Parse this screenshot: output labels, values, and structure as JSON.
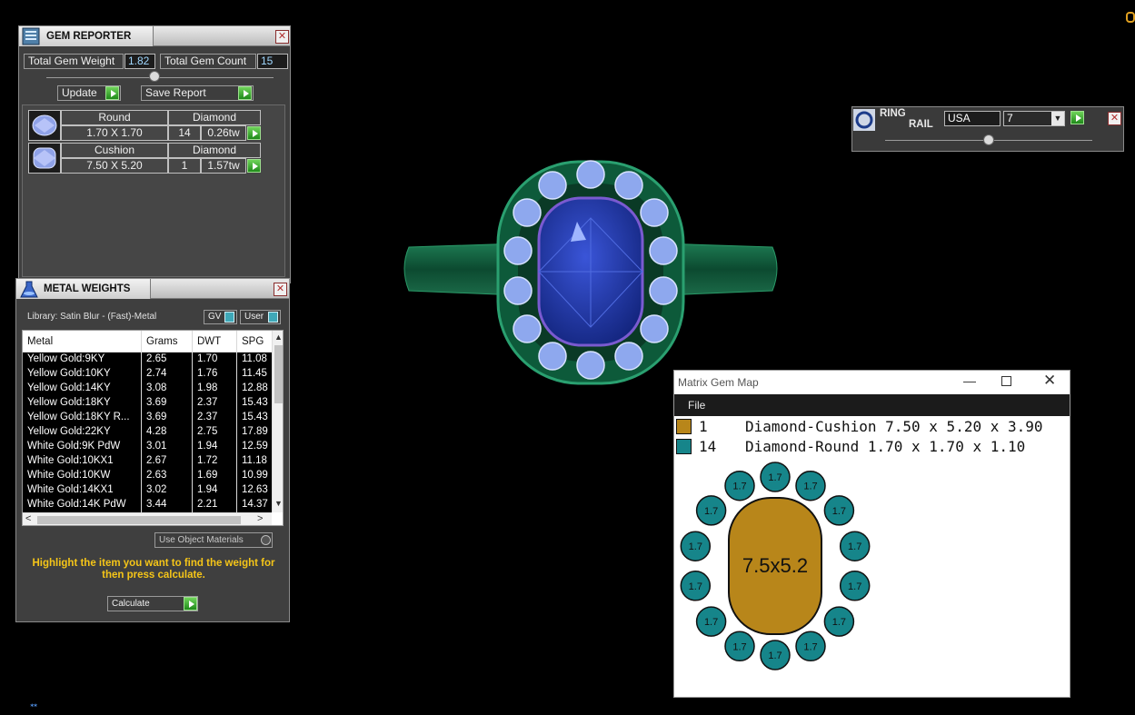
{
  "gem_reporter": {
    "title": "GEM REPORTER",
    "total_weight_label": "Total Gem Weight",
    "total_weight_value": "1.82",
    "total_count_label": "Total Gem Count",
    "total_count_value": "15",
    "update_label": "Update",
    "save_label": "Save Report",
    "gems": [
      {
        "shape": "Round",
        "type": "Diamond",
        "size": "1.70 X 1.70",
        "count": "14",
        "weight": "0.26tw"
      },
      {
        "shape": "Cushion",
        "type": "Diamond",
        "size": "7.50 X 5.20",
        "count": "1",
        "weight": "1.57tw"
      }
    ]
  },
  "metal_weights": {
    "title": "METAL WEIGHTS",
    "library": "Library: Satin Blur - (Fast)-Metal",
    "gv_label": "GV",
    "user_label": "User",
    "columns": [
      "Metal",
      "Grams",
      "DWT",
      "SPG"
    ],
    "rows": [
      [
        "Yellow Gold:9KY",
        "2.65",
        "1.70",
        "11.08"
      ],
      [
        "Yellow Gold:10KY",
        "2.74",
        "1.76",
        "11.45"
      ],
      [
        "Yellow Gold:14KY",
        "3.08",
        "1.98",
        "12.88"
      ],
      [
        "Yellow Gold:18KY",
        "3.69",
        "2.37",
        "15.43"
      ],
      [
        "Yellow Gold:18KY R...",
        "3.69",
        "2.37",
        "15.43"
      ],
      [
        "Yellow Gold:22KY",
        "4.28",
        "2.75",
        "17.89"
      ],
      [
        "White Gold:9K PdW",
        "3.01",
        "1.94",
        "12.59"
      ],
      [
        "White Gold:10KX1",
        "2.67",
        "1.72",
        "11.18"
      ],
      [
        "White Gold:10KW",
        "2.63",
        "1.69",
        "10.99"
      ],
      [
        "White Gold:14KX1",
        "3.02",
        "1.94",
        "12.63"
      ],
      [
        "White Gold:14K PdW",
        "3.44",
        "2.21",
        "14.37"
      ]
    ],
    "use_object_materials": "Use Object Materials",
    "hint": "Highlight the item you want to find the weight for then press calculate.",
    "calculate_label": "Calculate"
  },
  "ring_rail": {
    "title_line1": "RING",
    "title_line2": "RAIL",
    "region": "USA",
    "size": "7"
  },
  "gem_map": {
    "title": "Matrix Gem Map",
    "menu_file": "File",
    "legend": [
      {
        "count": "1",
        "desc": "Diamond-Cushion 7.50 x 5.20 x 3.90",
        "color": "#b8861a"
      },
      {
        "count": "14",
        "desc": "Diamond-Round 1.70 x 1.70 x 1.10",
        "color": "#16858a"
      }
    ],
    "center_label": "7.5x5.2",
    "stone_label": "1.7",
    "stone_count": 14
  },
  "colors": {
    "panel_bg": "#3f3f3f",
    "accent_yellow": "#f5c518",
    "cushion": "#b8861a",
    "round": "#16858a",
    "metal_green": "#0f5a3c",
    "sapphire": "#2a3fb0"
  }
}
